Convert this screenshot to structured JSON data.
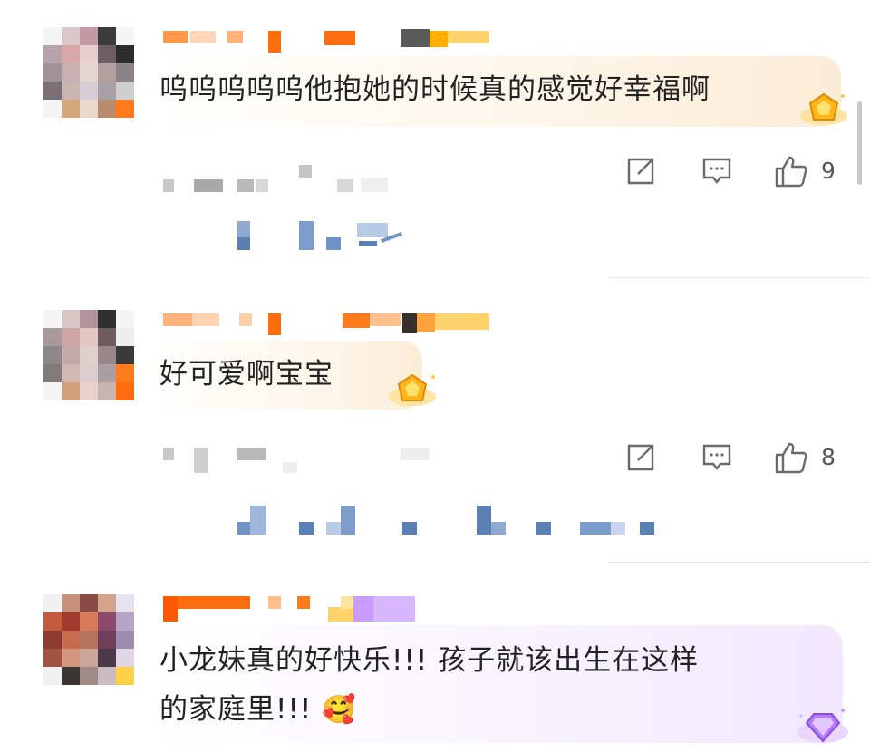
{
  "comments": [
    {
      "text_lines": [
        "呜呜呜呜呜他抱她的时候真的感觉好幸福啊"
      ],
      "like_count": "9",
      "badge": "gold-crown-badge"
    },
    {
      "text_lines": [
        "好可爱啊宝宝"
      ],
      "like_count": "8",
      "badge": "gold-crown-badge"
    },
    {
      "text_lines": [
        "小龙妹真的好快乐!!! 孩子就该出生在这样",
        "的家庭里!!! "
      ],
      "emoji": "🥰",
      "badge": "purple-gem-badge"
    }
  ],
  "icons": [
    "share-icon",
    "comment-icon",
    "like-icon"
  ],
  "colors": {
    "bubble_gold": "#fdf3e3",
    "bubble_purple": "#f5efff",
    "username_orange": "#ff7a1a",
    "username_gold": "#ffd36b",
    "username_purple": "#c79bff",
    "meta_gray": "#c9c9c9",
    "reply_blue": "#6f93c4",
    "icon_gray": "#6a6a6a"
  }
}
